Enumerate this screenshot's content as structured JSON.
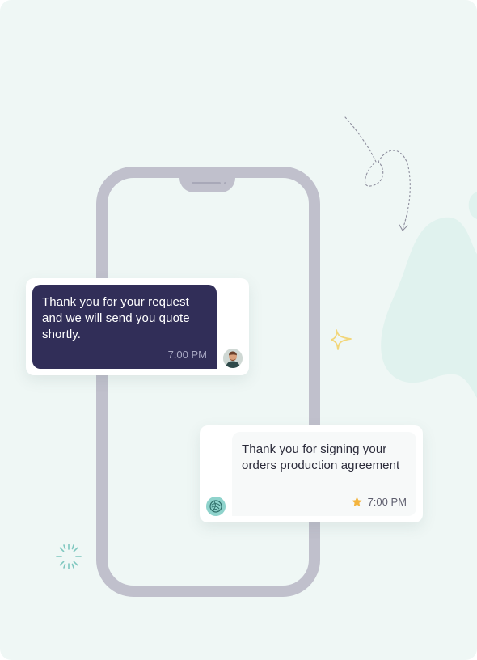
{
  "messages": [
    {
      "text": "Thank you for your request and we will send you quote shortly.",
      "time": "7:00 PM",
      "avatar": "person-avatar"
    },
    {
      "text": "Thank you for signing your orders production agreement",
      "time": "7:00 PM",
      "status_icon": "star-icon",
      "avatar": "company-logo-avatar"
    }
  ],
  "colors": {
    "background": "#eff7f5",
    "phone_frame": "#c0c0cc",
    "dark_bubble": "#312e58",
    "light_bubble": "#f7f9f9",
    "star": "#f3b43f",
    "blob": "#e0f2ee"
  }
}
